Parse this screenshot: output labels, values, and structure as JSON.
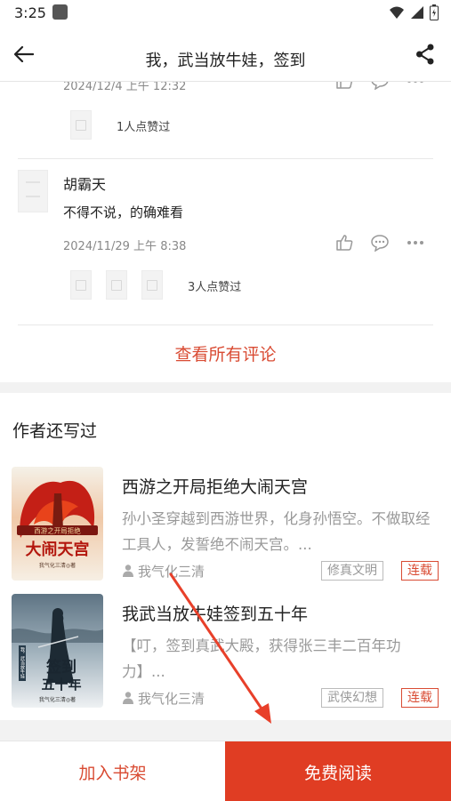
{
  "status_bar": {
    "time": "3:25"
  },
  "app_bar": {
    "title": "我，武当放牛娃，签到",
    "back_icon": "arrow-left-icon",
    "share_icon": "share-icon"
  },
  "comments": {
    "first": {
      "date": "2024/12/4 上午 12:32",
      "likes": "1人点赞过"
    },
    "second": {
      "user": "胡霸天",
      "text": "不得不说，的确难看",
      "date": "2024/11/29 上午 8:38",
      "likes": "3人点赞过"
    },
    "view_all": "查看所有评论"
  },
  "author_works": {
    "title": "作者还写过",
    "books": [
      {
        "title": "西游之开局拒绝大闹天宫",
        "description": "孙小圣穿越到西游世界，化身孙悟空。不做取经工具人，发誓绝不闹天宫。...",
        "author": "我气化三清",
        "genre": "修真文明",
        "status": "连载",
        "cover_text": [
          "西游之开局拒绝",
          "大闹天宫",
          "我气化三清◎著"
        ]
      },
      {
        "title": "我武当放牛娃签到五十年",
        "description": "【叮，签到真武大殿，获得张三丰二百年功力】...",
        "author": "我气化三清",
        "genre": "武侠幻想",
        "status": "连载",
        "cover_text": [
          "我，武当放牛娃",
          "签到",
          "五十年",
          "我气化三清◎著"
        ]
      }
    ]
  },
  "bottom_bar": {
    "add_shelf": "加入书架",
    "read_free": "免费阅读"
  },
  "colors": {
    "accent": "#e03d23",
    "accent_text": "#d94b33",
    "muted": "#999999"
  }
}
